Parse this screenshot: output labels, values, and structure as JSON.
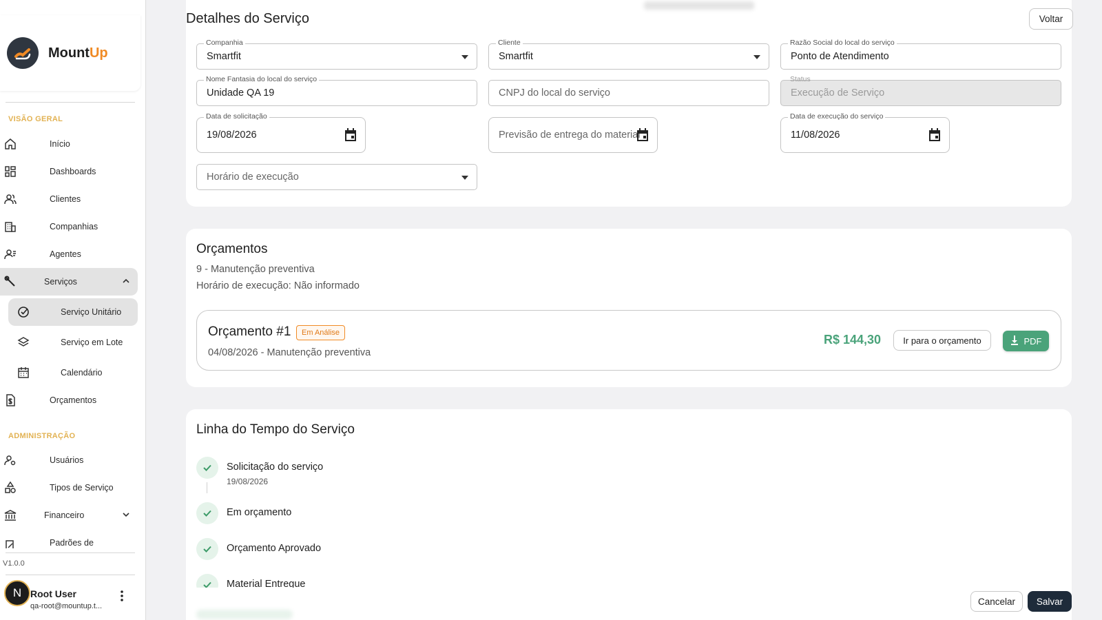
{
  "brand": {
    "name_part1": "Mount",
    "name_part2": "Up"
  },
  "sidebar": {
    "section_overview": "VISÃO GERAL",
    "section_admin": "ADMINISTRAÇÃO",
    "items": {
      "inicio": "Início",
      "dashboards": "Dashboards",
      "clientes": "Clientes",
      "companhias": "Companhias",
      "agentes": "Agentes",
      "servicos": "Serviços",
      "servico_unitario": "Serviço Unitário",
      "servico_lote": "Serviço em Lote",
      "calendario": "Calendário",
      "orcamentos": "Orçamentos",
      "usuarios": "Usuários",
      "tipos_servico": "Tipos de Serviço",
      "financeiro": "Financeiro",
      "padroes": "Padrões de"
    },
    "version": "V1.0.0",
    "user": {
      "initial": "N",
      "name": "Root User",
      "email": "qa-root@mountup.t..."
    }
  },
  "details": {
    "title": "Detalhes do Serviço",
    "back_label": "Voltar",
    "fields": {
      "companhia": {
        "label": "Companhia",
        "value": "Smartfit"
      },
      "cliente": {
        "label": "Cliente",
        "value": "Smartfit"
      },
      "razao_social": {
        "label": "Razão Social do local do serviço",
        "value": "Ponto de Atendimento"
      },
      "nome_fantasia": {
        "label": "Nome Fantasia do local do serviço",
        "value": "Unidade QA 19"
      },
      "cnpj": {
        "placeholder": "CNPJ do local do serviço"
      },
      "status": {
        "label": "Status",
        "value": "Execução de Serviço"
      },
      "data_solicitacao": {
        "label": "Data de solicitação",
        "value": "19/08/2026"
      },
      "previsao_entrega": {
        "placeholder": "Previsão de entrega do material"
      },
      "data_execucao": {
        "label": "Data de execução do serviço",
        "value": "11/08/2026"
      },
      "horario_execucao": {
        "placeholder": "Horário de execução"
      }
    }
  },
  "budgets": {
    "title": "Orçamentos",
    "service_line": "9 - Manutenção preventiva",
    "schedule_line": "Horário de execução: Não informado",
    "item": {
      "title": "Orçamento #1",
      "status": "Em Análise",
      "subtitle": "04/08/2026 - Manutenção preventiva",
      "price": "R$ 144,30",
      "goto_label": "Ir para o orçamento",
      "pdf_label": "PDF"
    }
  },
  "timeline": {
    "title": "Linha do Tempo do Serviço",
    "steps": [
      {
        "title": "Solicitação do serviço",
        "date": "19/08/2026"
      },
      {
        "title": "Em orçamento"
      },
      {
        "title": "Orçamento Aprovado"
      },
      {
        "title": "Material Entregue"
      }
    ]
  },
  "footer": {
    "cancel_label": "Cancelar",
    "save_label": "Salvar"
  },
  "colors": {
    "accent": "#f08a24",
    "brand_dark": "#1e2b3a",
    "success": "#4aa37a",
    "section_label": "#e2b253"
  }
}
